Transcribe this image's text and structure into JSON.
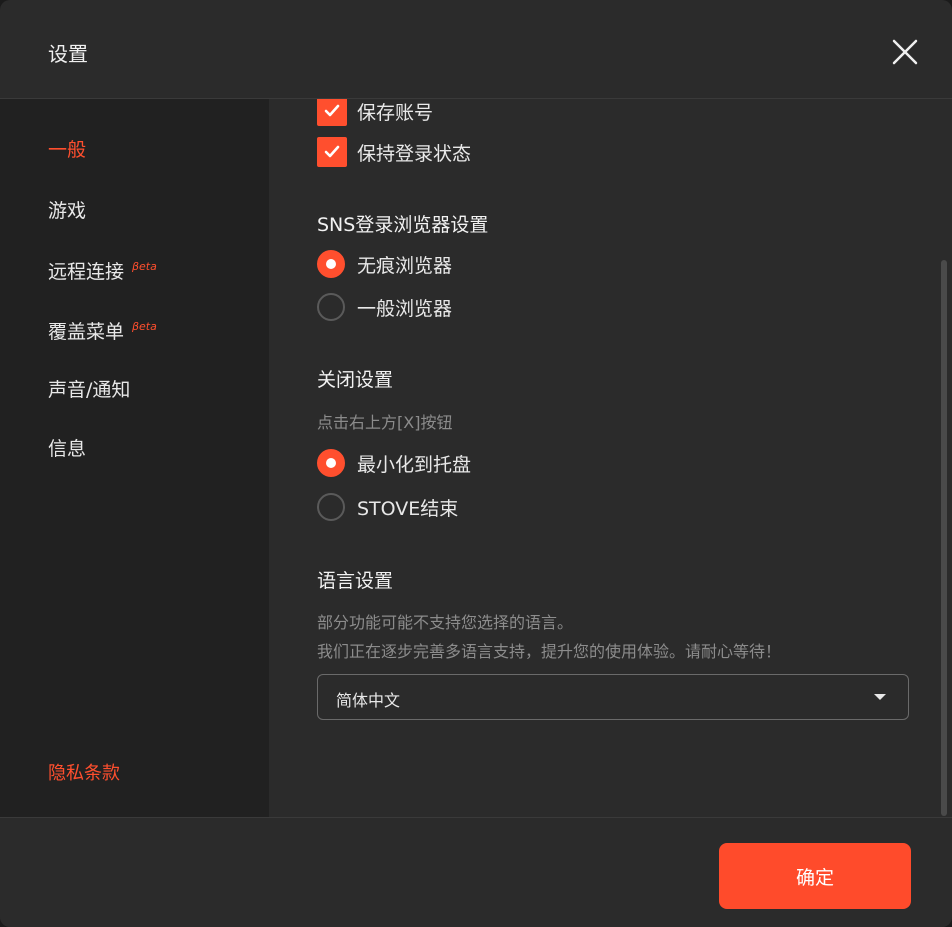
{
  "colors": {
    "accent": "#ff4f2e",
    "background": "#2b2b2b",
    "sidebar": "#212121"
  },
  "header": {
    "title": "设置",
    "close_icon": "close-icon"
  },
  "sidebar": {
    "items": [
      {
        "label": "一般",
        "active": true
      },
      {
        "label": "游戏"
      },
      {
        "label": "远程连接",
        "badge": "βeta"
      },
      {
        "label": "覆盖菜单",
        "badge": "βeta"
      },
      {
        "label": "声音/通知"
      },
      {
        "label": "信息"
      }
    ],
    "privacy_label": "隐私条款"
  },
  "content": {
    "checkboxes": [
      {
        "label": "保存账号",
        "checked": true
      },
      {
        "label": "保持登录状态",
        "checked": true
      }
    ],
    "sns": {
      "title": "SNS登录浏览器设置",
      "options": [
        {
          "label": "无痕浏览器",
          "selected": true
        },
        {
          "label": "一般浏览器",
          "selected": false
        }
      ]
    },
    "close": {
      "title": "关闭设置",
      "desc": "点击右上方[X]按钮",
      "options": [
        {
          "label": "最小化到托盘",
          "selected": true
        },
        {
          "label": "STOVE结束",
          "selected": false
        }
      ]
    },
    "language": {
      "title": "语言设置",
      "desc1": "部分功能可能不支持您选择的语言。",
      "desc2": "我们正在逐步完善多语言支持，提升您的使用体验。请耐心等待！",
      "selected": "简体中文"
    }
  },
  "footer": {
    "confirm_label": "确定"
  }
}
